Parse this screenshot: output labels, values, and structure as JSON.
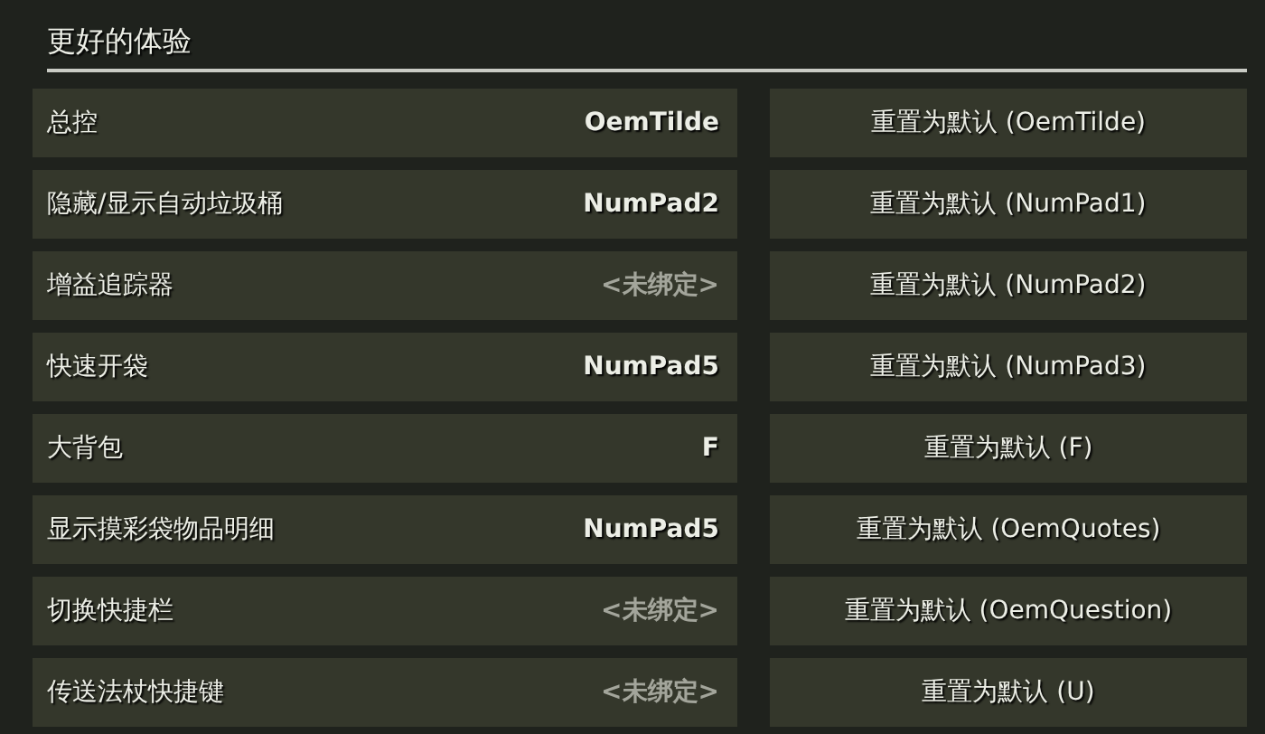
{
  "section": {
    "title": "更好的体验"
  },
  "bindings": [
    {
      "action": "总控",
      "key": "OemTilde",
      "bound": true,
      "reset": "重置为默认 (OemTilde)"
    },
    {
      "action": "隐藏/显示自动垃圾桶",
      "key": "NumPad2",
      "bound": true,
      "reset": "重置为默认 (NumPad1)"
    },
    {
      "action": "增益追踪器",
      "key": "<未绑定>",
      "bound": false,
      "reset": "重置为默认 (NumPad2)"
    },
    {
      "action": "快速开袋",
      "key": "NumPad5",
      "bound": true,
      "reset": "重置为默认 (NumPad3)"
    },
    {
      "action": "大背包",
      "key": "F",
      "bound": true,
      "reset": "重置为默认 (F)"
    },
    {
      "action": "显示摸彩袋物品明细",
      "key": "NumPad5",
      "bound": true,
      "reset": "重置为默认 (OemQuotes)"
    },
    {
      "action": "切换快捷栏",
      "key": "<未绑定>",
      "bound": false,
      "reset": "重置为默认 (OemQuestion)"
    },
    {
      "action": "传送法杖快捷键",
      "key": "<未绑定>",
      "bound": false,
      "reset": "重置为默认 (U)"
    }
  ]
}
